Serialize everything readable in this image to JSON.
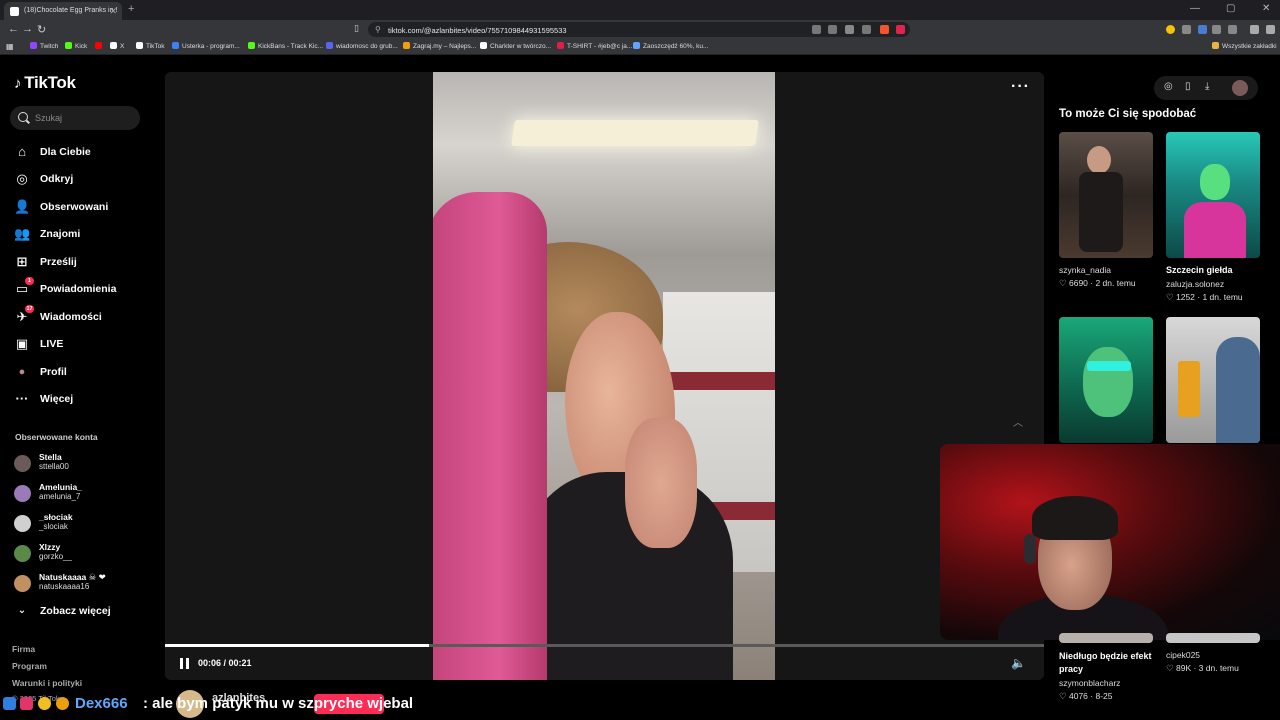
{
  "browser": {
    "tab_title": "(18)Chocolate Egg Pranks in !",
    "url": "tiktok.com/@azlanbites/video/7557109844931595533",
    "bookmarks": [
      {
        "label": "Twitch",
        "color": "#9146ff"
      },
      {
        "label": "Kick",
        "color": "#53fc18"
      },
      {
        "label": "",
        "color": "#ff0000"
      },
      {
        "label": "X",
        "color": "#ffffff"
      },
      {
        "label": "TikTok",
        "color": "#ffffff"
      },
      {
        "label": "Usterka - program...",
        "color": "#3b82f6"
      },
      {
        "label": "KickBans - Track Kic...",
        "color": "#53fc18"
      },
      {
        "label": "wiadomosc do grub...",
        "color": "#5865f2"
      },
      {
        "label": "Zagraj.my – Najleps...",
        "color": "#f59e0b"
      },
      {
        "label": "Charkter w twórczo...",
        "color": "#ffffff"
      },
      {
        "label": "T-SHIRT - #jeb@c ja...",
        "color": "#e11d48"
      },
      {
        "label": "Zaoszczędź 60%, ku...",
        "color": "#60a5fa"
      }
    ],
    "all_bookmarks": "Wszystkie zakładki"
  },
  "sidebar": {
    "logo": "TikTok",
    "search_placeholder": "Szukaj",
    "nav": [
      {
        "label": "Dla Ciebie",
        "icon": "home-icon",
        "glyph": "⌂",
        "badge": ""
      },
      {
        "label": "Odkryj",
        "icon": "compass-icon",
        "glyph": "◎",
        "badge": ""
      },
      {
        "label": "Obserwowani",
        "icon": "following-icon",
        "glyph": "👤",
        "badge": ""
      },
      {
        "label": "Znajomi",
        "icon": "friends-icon",
        "glyph": "👥",
        "badge": ""
      },
      {
        "label": "Prześlij",
        "icon": "upload-icon",
        "glyph": "⊞",
        "badge": ""
      },
      {
        "label": "Powiadomienia",
        "icon": "notifications-icon",
        "glyph": "▭",
        "badge": "1"
      },
      {
        "label": "Wiadomości",
        "icon": "messages-icon",
        "glyph": "✈",
        "badge": "17"
      },
      {
        "label": "LIVE",
        "icon": "live-icon",
        "glyph": "▣",
        "badge": ""
      },
      {
        "label": "Profil",
        "icon": "profile-icon",
        "glyph": "●",
        "badge": ""
      },
      {
        "label": "Więcej",
        "icon": "more-icon",
        "glyph": "···",
        "badge": ""
      }
    ],
    "following_title": "Obserwowane konta",
    "accounts": [
      {
        "name": "Stella",
        "handle": "sttella00",
        "color": "#6b5a5a"
      },
      {
        "name": "Amelunia_",
        "handle": "amelunia_7",
        "color": "#9a7ab8"
      },
      {
        "name": "_słociak",
        "handle": "_slociak",
        "color": "#d0d0d0"
      },
      {
        "name": "Xlzzy",
        "handle": "gorzko__",
        "color": "#5a8a4a"
      },
      {
        "name": "Natuskaaaa ☠ ❤",
        "handle": "natuskaaaa16",
        "color": "#c09060"
      }
    ],
    "see_more": "Zobacz więcej",
    "footer": [
      "Firma",
      "Program",
      "Warunki i polityki",
      "© 2025 TikTok"
    ]
  },
  "player": {
    "time": "00:06 / 00:21",
    "progress": 0.3,
    "author": "azlanbites"
  },
  "recommendations": {
    "title": "To może Ci się spodobać",
    "items": [
      {
        "title": "szynka_nadia",
        "bold": false,
        "author": "",
        "likes": "6690",
        "age": "2 dn. temu"
      },
      {
        "title": "Szczecin giełda",
        "bold": true,
        "author": "zaluzja.solonez",
        "likes": "1252",
        "age": "1 dn. temu"
      },
      {
        "title": "Niedługo będzie efekt pracy",
        "bold": true,
        "author": "szymonblacharz",
        "likes": "4076",
        "age": "8-25"
      },
      {
        "title": "cipek025",
        "bold": false,
        "author": "",
        "likes": "89K",
        "age": "3 dn. temu"
      }
    ]
  },
  "chat": {
    "user": "Dex666",
    "message": ": ale bym patyk mu w szpryche wjebal",
    "user_color": "#60a8ff"
  }
}
